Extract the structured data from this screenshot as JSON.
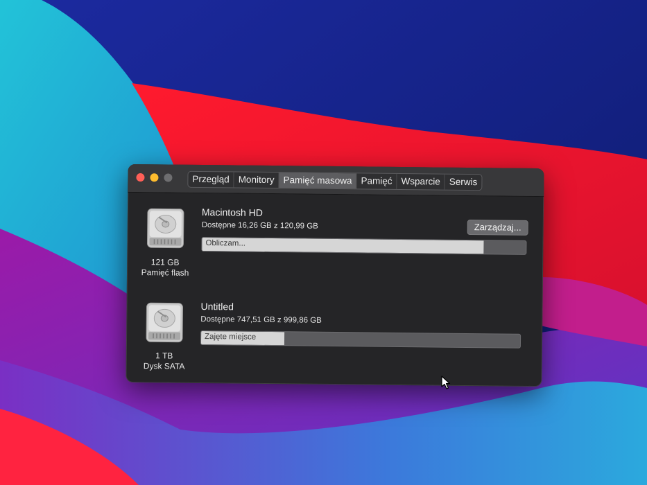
{
  "tabs": [
    {
      "label": "Przegląd",
      "active": false
    },
    {
      "label": "Monitory",
      "active": false
    },
    {
      "label": "Pamięć masowa",
      "active": true
    },
    {
      "label": "Pamięć",
      "active": false
    },
    {
      "label": "Wsparcie",
      "active": false
    },
    {
      "label": "Serwis",
      "active": false
    }
  ],
  "volumes": [
    {
      "name": "Macintosh HD",
      "available": "Dostępne 16,26 GB z 120,99 GB",
      "capacity": "121 GB",
      "type": "Pamięć flash",
      "bar_label": "Obliczam...",
      "fill_fraction": 0.87,
      "manage_label": "Zarządzaj..."
    },
    {
      "name": "Untitled",
      "available": "Dostępne 747,51 GB z 999,86 GB",
      "capacity": "1 TB",
      "type": "Dysk SATA",
      "bar_label": "Zajęte miejsce",
      "fill_fraction": 0.26
    }
  ],
  "colors": {
    "window_bg": "#252527",
    "titlebar_bg": "#38383a",
    "close": "#ff5f57",
    "minimize": "#febc2e",
    "zoom_disabled": "#6e6e70",
    "bar_fill": "#d6d6d6",
    "bar_track": "#5b5b5e"
  },
  "icons": {
    "disk": "hard-drive-icon",
    "pointer": "mouse-pointer-icon"
  }
}
